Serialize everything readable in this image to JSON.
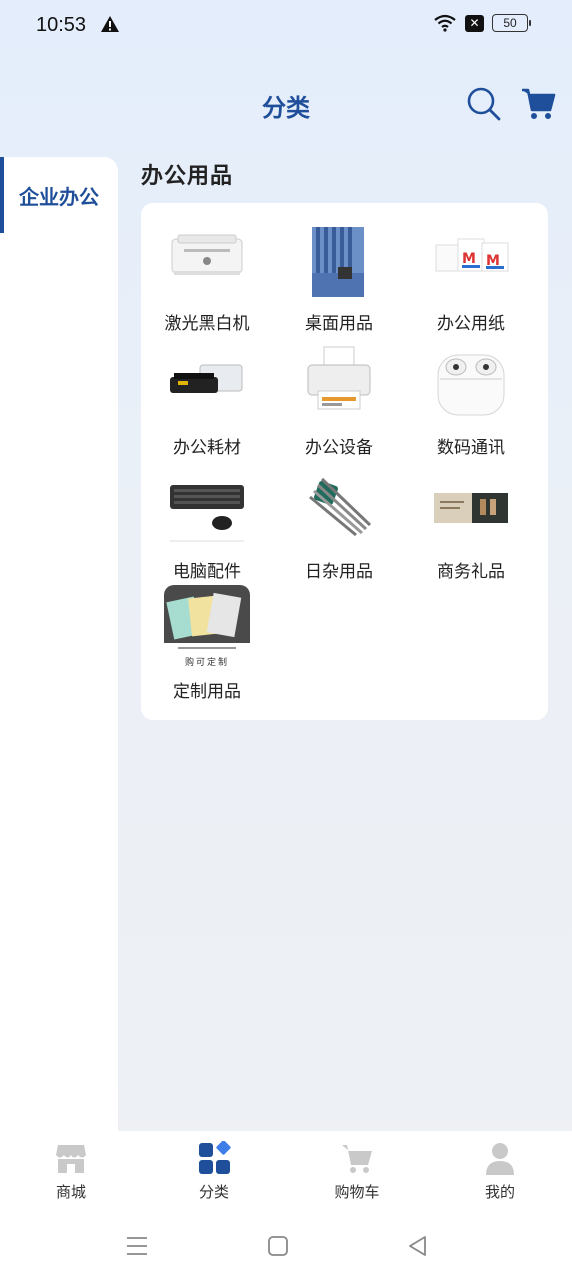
{
  "status": {
    "time": "10:53",
    "battery": "50"
  },
  "header": {
    "title": "分类"
  },
  "sidebar": {
    "items": [
      {
        "label": "企业办公"
      }
    ]
  },
  "section": {
    "title": "办公用品"
  },
  "categories": [
    {
      "name": "激光黑白机",
      "icon": "laser-printer-icon"
    },
    {
      "name": "桌面用品",
      "icon": "desk-organizer-icon"
    },
    {
      "name": "办公用纸",
      "icon": "paper-ream-icon"
    },
    {
      "name": "办公耗材",
      "icon": "toner-cartridge-icon"
    },
    {
      "name": "办公设备",
      "icon": "inkjet-printer-icon"
    },
    {
      "name": "数码通讯",
      "icon": "earbuds-case-icon"
    },
    {
      "name": "电脑配件",
      "icon": "keyboard-mouse-icon"
    },
    {
      "name": "日杂用品",
      "icon": "hex-key-set-icon"
    },
    {
      "name": "商务礼品",
      "icon": "gift-set-icon"
    },
    {
      "name": "定制用品",
      "icon": "custom-notebook-icon",
      "overlay": "购可定制"
    }
  ],
  "bottom_nav": [
    {
      "label": "商城",
      "icon": "store-icon",
      "active": false
    },
    {
      "label": "分类",
      "icon": "category-icon",
      "active": true
    },
    {
      "label": "购物车",
      "icon": "cart-icon",
      "active": false
    },
    {
      "label": "我的",
      "icon": "user-icon",
      "active": false
    }
  ],
  "colors": {
    "accent": "#1f4e9a",
    "inactive": "#c9c9c9"
  }
}
